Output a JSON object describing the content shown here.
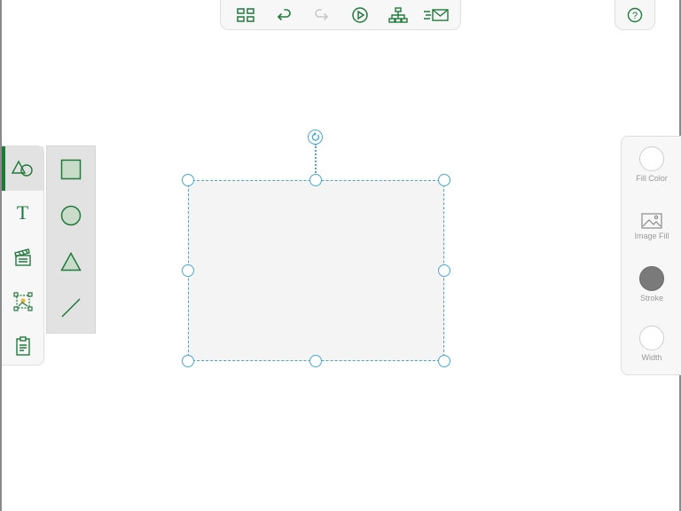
{
  "toolbar": {
    "buttons": [
      {
        "icon": "grid-view-icon"
      },
      {
        "icon": "undo-icon"
      },
      {
        "icon": "redo-icon"
      },
      {
        "icon": "play-icon"
      },
      {
        "icon": "sitemap-icon"
      },
      {
        "icon": "send-mail-icon"
      }
    ]
  },
  "help": {
    "icon": "help-icon",
    "label": "?"
  },
  "left_tools": [
    {
      "icon": "shapes-icon",
      "active": true
    },
    {
      "icon": "text-icon",
      "label": "T"
    },
    {
      "icon": "media-icon"
    },
    {
      "icon": "image-insert-icon"
    },
    {
      "icon": "clipboard-icon"
    }
  ],
  "shape_panel": [
    {
      "icon": "square-shape-icon"
    },
    {
      "icon": "circle-shape-icon"
    },
    {
      "icon": "triangle-shape-icon"
    },
    {
      "icon": "line-shape-icon"
    }
  ],
  "properties": {
    "fill_color": "Fill Color",
    "image_fill": "Image Fill",
    "stroke": "Stroke",
    "width": "Width"
  },
  "colors": {
    "accent": "#1f7a3a",
    "selection": "#4aa7d8",
    "stroke_swatch": "#7a7a7a"
  }
}
